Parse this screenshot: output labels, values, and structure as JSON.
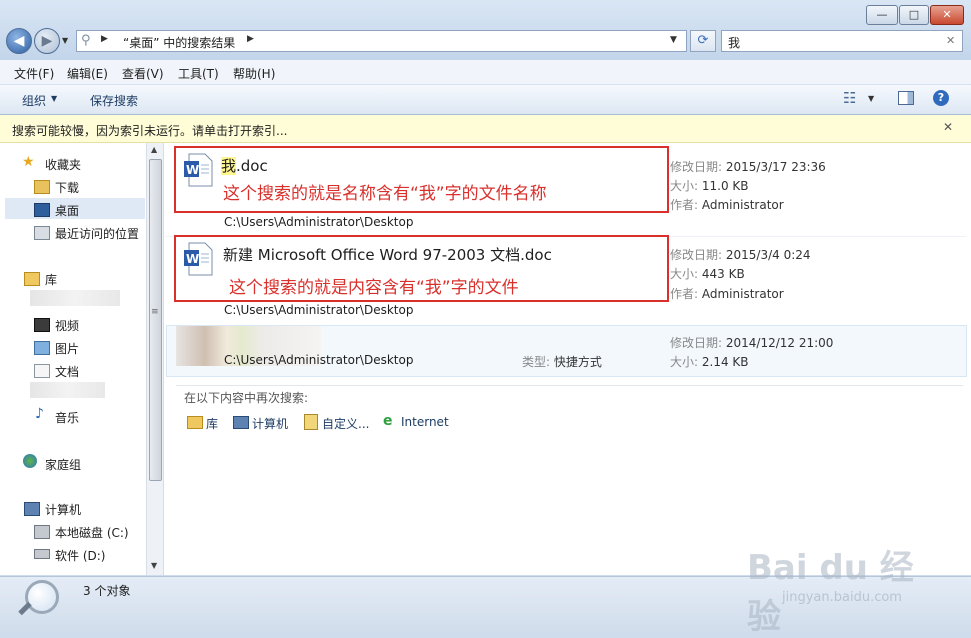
{
  "address": {
    "path": "“桌面” 中的搜索结果"
  },
  "search": {
    "query": "我"
  },
  "window_buttons": {
    "minimize": "—",
    "maximize": "□",
    "close": "✕"
  },
  "menu": {
    "items": [
      "文件(F)",
      "编辑(E)",
      "查看(V)",
      "工具(T)",
      "帮助(H)"
    ]
  },
  "toolbar": {
    "organize": "组织",
    "save_search": "保存搜索"
  },
  "infobar": {
    "text": "搜索可能较慢，因为索引未运行。请单击打开索引..."
  },
  "nav": {
    "favorites": "收藏夹",
    "downloads": "下载",
    "desktop": "桌面",
    "recent": "最近访问的位置",
    "libraries": "库",
    "videos": "视频",
    "pictures": "图片",
    "documents": "文档",
    "music": "音乐",
    "homegroup": "家庭组",
    "computer": "计算机",
    "local_disk": "本地磁盘 (C:)",
    "software": "软件 (D:)"
  },
  "results": [
    {
      "name_highlight": "我",
      "name_rest": ".doc",
      "annotation": "这个搜索的就是名称含有“我”字的文件名称",
      "path": "C:\\Users\\Administrator\\Desktop",
      "modified_label": "修改日期:",
      "modified": "2015/3/17 23:36",
      "size_label": "大小:",
      "size": "11.0 KB",
      "author_label": "作者:",
      "author": "Administrator"
    },
    {
      "name": "新建 Microsoft Office Word 97-2003 文档.doc",
      "annotation": "这个搜索的就是内容含有“我”字的文件",
      "path": "C:\\Users\\Administrator\\Desktop",
      "modified_label": "修改日期:",
      "modified": "2015/3/4 0:24",
      "size_label": "大小:",
      "size": "443 KB",
      "author_label": "作者:",
      "author": "Administrator"
    },
    {
      "path": "C:\\Users\\Administrator\\Desktop",
      "type_label": "类型:",
      "type": "快捷方式",
      "modified_label": "修改日期:",
      "modified": "2014/12/12 21:00",
      "size_label": "大小:",
      "size": "2.14 KB"
    }
  ],
  "search_again": {
    "label": "在以下内容中再次搜索:",
    "options": [
      "库",
      "计算机",
      "自定义...",
      "Internet"
    ]
  },
  "status": {
    "count": "3 个对象"
  },
  "watermark": {
    "brand": "Bai du 经验",
    "url": "jingyan.baidu.com"
  }
}
